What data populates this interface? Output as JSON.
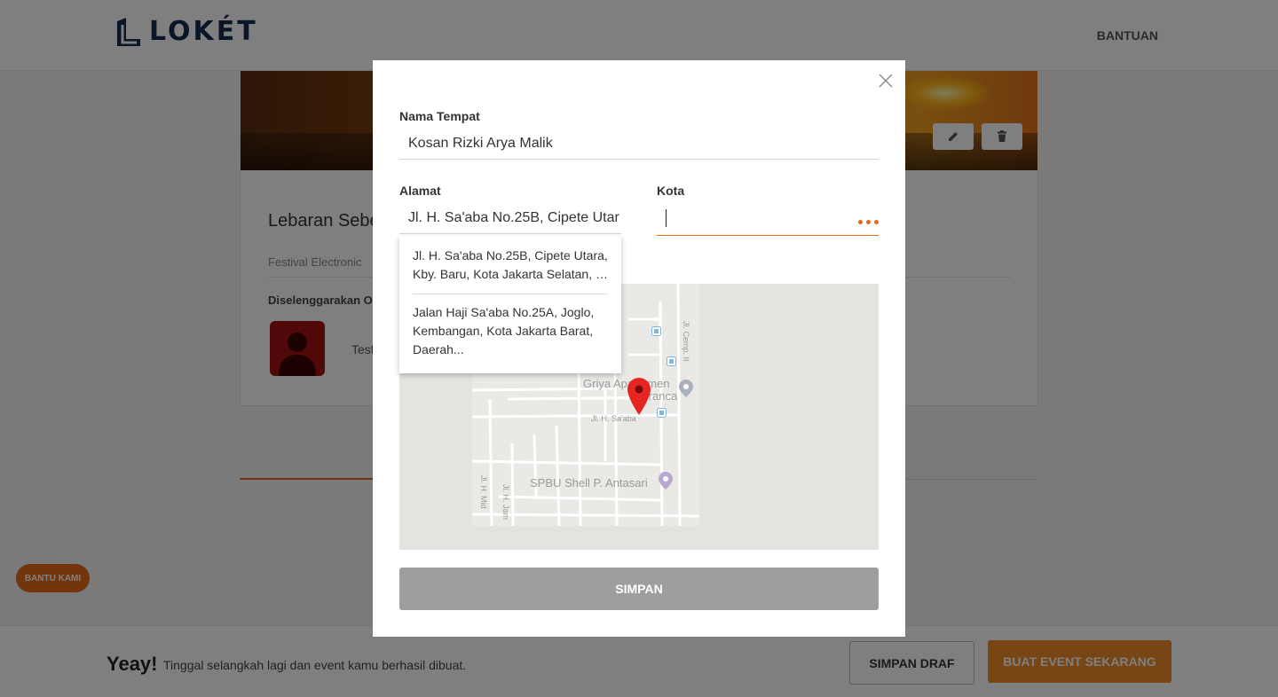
{
  "header": {
    "logo_text": "LOKÉT",
    "help_link": "BANTUAN"
  },
  "event": {
    "title": "Lebaran Sebe",
    "category": "Festival Electronic",
    "organizer_label": "Diselenggarakan O",
    "organizer_name": "Test"
  },
  "help_button": "BANTU KAMI",
  "footer": {
    "yeay": "Yeay!",
    "message": "Tinggal selangkah lagi dan event kamu berhasil dibuat.",
    "save_draft": "SIMPAN DRAF",
    "create_event": "BUAT EVENT SEKARANG"
  },
  "modal": {
    "place_name": {
      "label": "Nama Tempat",
      "value": "Kosan Rizki Arya Malik"
    },
    "address": {
      "label": "Alamat",
      "value": "Jl. H. Sa'aba No.25B, Cipete Utar"
    },
    "city": {
      "label": "Kota",
      "value": ""
    },
    "suggestions": [
      {
        "lines": [
          "Jl. H. Sa'aba No.25B, Cipete Utara,",
          "Kby. Baru, Kota Jakarta Selatan, D..."
        ]
      },
      {
        "lines": [
          "Jalan Haji Sa'aba No.25A, Joglo,",
          "Kembangan, Kota Jakarta Barat,",
          "Daerah..."
        ]
      }
    ],
    "map": {
      "poi_1_line1": "Griya Apartemen",
      "poi_1_line2": "Pranca",
      "poi_2": "SPBU Shell P. Antasari",
      "street_1": "Jl. H. Sa'aba",
      "street_2": "Jl. Cemp. II",
      "street_3": "Jl. H. Jam",
      "street_4": "Jl. H. Mid"
    },
    "save_button": "SIMPAN"
  },
  "colors": {
    "accent": "#e46a19",
    "brand": "#152c4e",
    "save_disabled": "#9e9e9e",
    "pin": "#e52521"
  }
}
